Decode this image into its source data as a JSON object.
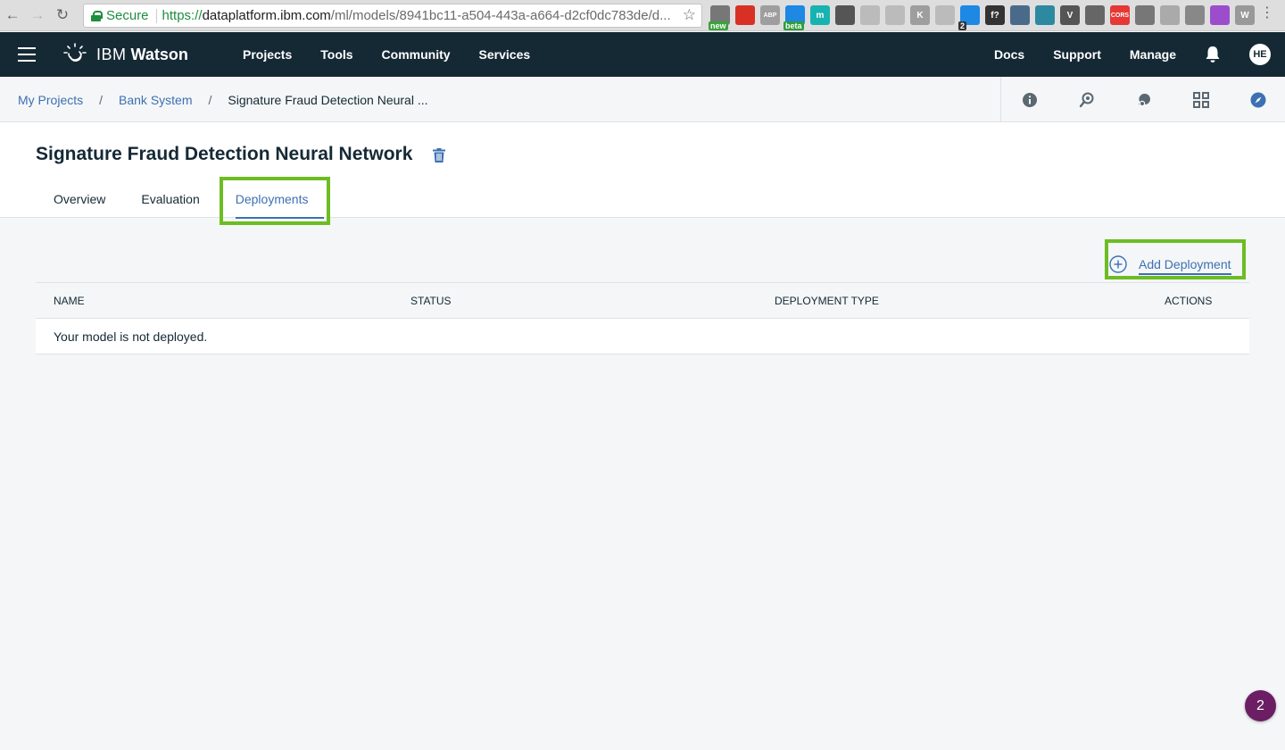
{
  "browser": {
    "secure_label": "Secure",
    "url_scheme": "https://",
    "url_host": "dataplatform.ibm.com",
    "url_path": "/ml/models/8941bc11-a504-443a-a664-d2cf0dc783de/d...",
    "extensions": [
      {
        "icon": "printer-new-icon",
        "color": "#777777",
        "badge": "new",
        "badge_color": "#3aa33a"
      },
      {
        "icon": "red-shield-icon",
        "color": "#d93025",
        "badge": ""
      },
      {
        "icon": "abp-icon",
        "color": "#9e9e9e",
        "text": "ABP",
        "badge": ""
      },
      {
        "icon": "folder-beta-icon",
        "color": "#1e88e5",
        "badge": "beta",
        "badge_color": "#2e9d3e"
      },
      {
        "icon": "m-icon",
        "color": "#18b3b0",
        "text": "m",
        "badge": ""
      },
      {
        "icon": "ball-icon",
        "color": "#555555",
        "badge": ""
      },
      {
        "icon": "pin-icon",
        "color": "#bbbbbb",
        "badge": ""
      },
      {
        "icon": "ruler-icon",
        "color": "#bbbbbb",
        "badge": ""
      },
      {
        "icon": "k-icon",
        "color": "#9e9e9e",
        "text": "K",
        "badge": ""
      },
      {
        "icon": "sync-icon",
        "color": "#bbbbbb",
        "badge": ""
      },
      {
        "icon": "ghost-icon",
        "color": "#1e88e5",
        "badge": "2",
        "badge_color": "#333333"
      },
      {
        "icon": "function-icon",
        "color": "#333333",
        "text": "f?",
        "badge": ""
      },
      {
        "icon": "eyedropper-icon",
        "color": "#4a6a8a",
        "badge": ""
      },
      {
        "icon": "react-icon",
        "color": "#2c89a0",
        "badge": ""
      },
      {
        "icon": "v-icon",
        "color": "#555555",
        "text": "V",
        "badge": ""
      },
      {
        "icon": "target-icon",
        "color": "#666666",
        "badge": ""
      },
      {
        "icon": "cors-icon",
        "color": "#e53935",
        "text": "CORS",
        "badge": ""
      },
      {
        "icon": "hat-icon",
        "color": "#777777",
        "badge": ""
      },
      {
        "icon": "note-icon",
        "color": "#aaaaaa",
        "badge": ""
      },
      {
        "icon": "monitor-icon",
        "color": "#888888",
        "badge": ""
      },
      {
        "icon": "puzzle-icon",
        "color": "#9c4dcc",
        "badge": ""
      },
      {
        "icon": "w-icon",
        "color": "#999999",
        "text": "W",
        "badge": ""
      }
    ]
  },
  "topnav": {
    "brand_ibm": "IBM",
    "brand_watson": "Watson",
    "main": [
      "Projects",
      "Tools",
      "Community",
      "Services"
    ],
    "right": [
      "Docs",
      "Support",
      "Manage"
    ],
    "avatar_initials": "HE"
  },
  "breadcrumb": {
    "items": [
      "My Projects",
      "Bank System"
    ],
    "separator": "/",
    "current": "Signature Fraud Detection Neural ..."
  },
  "page": {
    "title": "Signature Fraud Detection Neural Network",
    "tabs": [
      {
        "label": "Overview",
        "active": false
      },
      {
        "label": "Evaluation",
        "active": false
      },
      {
        "label": "Deployments",
        "active": true
      }
    ],
    "add_deployment_label": "Add Deployment"
  },
  "table": {
    "headers": [
      "NAME",
      "STATUS",
      "DEPLOYMENT TYPE",
      "ACTIONS"
    ],
    "empty_message": "Your model is not deployed."
  },
  "float_badge": "2",
  "colors": {
    "nav_bg": "#152935",
    "link": "#3d70b2",
    "highlight": "#6dbd22",
    "badge": "#6b1e63"
  }
}
